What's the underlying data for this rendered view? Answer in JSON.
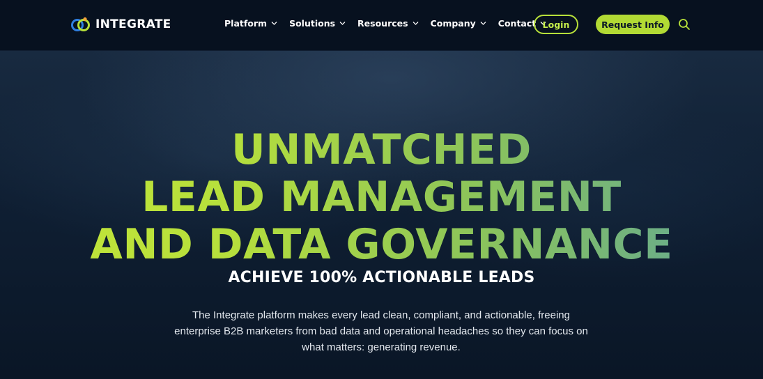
{
  "header": {
    "brand": "INTEGRATE",
    "nav": [
      {
        "label": "Platform"
      },
      {
        "label": "Solutions"
      },
      {
        "label": "Resources"
      },
      {
        "label": "Company"
      },
      {
        "label": "Contact"
      }
    ],
    "login_label": "Login",
    "request_label": "Request Info",
    "icons": {
      "search": "search-icon",
      "chevron": "chevron-down-icon"
    }
  },
  "hero": {
    "headline": [
      "UNMATCHED",
      "LEAD MANAGEMENT",
      "AND DATA GOVERNANCE"
    ],
    "subheadline": "ACHIEVE 100% ACTIONABLE LEADS",
    "description": "The Integrate platform makes every lead clean, compliant, and actionable, freeing enterprise B2B marketers from bad data and operational headaches so they can focus on what matters: generating revenue."
  },
  "colors": {
    "accent": "#b2da34",
    "background": "#0a1626",
    "header_bg": "#07111f",
    "gradient_start": "#c4e638",
    "gradient_end": "#5ea59a"
  }
}
